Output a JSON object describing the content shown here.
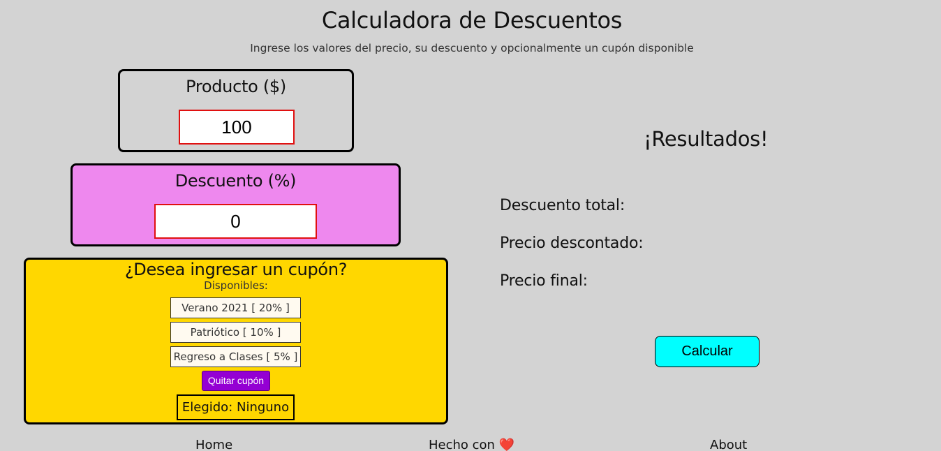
{
  "header": {
    "title": "Calculadora de Descuentos",
    "subtitle": "Ingrese los valores del precio, su descuento y opcionalmente un cupón disponible"
  },
  "producto": {
    "label": "Producto ($)",
    "value": "100"
  },
  "descuento": {
    "label": "Descuento (%)",
    "value": "0"
  },
  "cupon": {
    "title": "¿Desea ingresar un cupón?",
    "subtitle": "Disponibles:",
    "options": [
      "Verano 2021 [ 20% ]",
      "Patriótico [ 10% ]",
      "Regreso a Clases [ 5% ]"
    ],
    "remove_label": "Quitar cupón",
    "selected": "Elegido: Ninguno"
  },
  "results": {
    "title": "¡Resultados!",
    "descuento_total": "Descuento total:",
    "precio_descontado": "Precio descontado:",
    "precio_final": "Precio final:",
    "calc_label": "Calcular"
  },
  "footer": {
    "home": "Home",
    "hecho": "Hecho con",
    "heart": "❤️",
    "about": "About"
  },
  "colors": {
    "background": "#d3d3d3",
    "descuento_box": "#ee88ee",
    "cupon_box": "#ffd700",
    "remove_button": "#9400d3",
    "calc_button": "#00ffff",
    "input_border": "#e01010"
  }
}
